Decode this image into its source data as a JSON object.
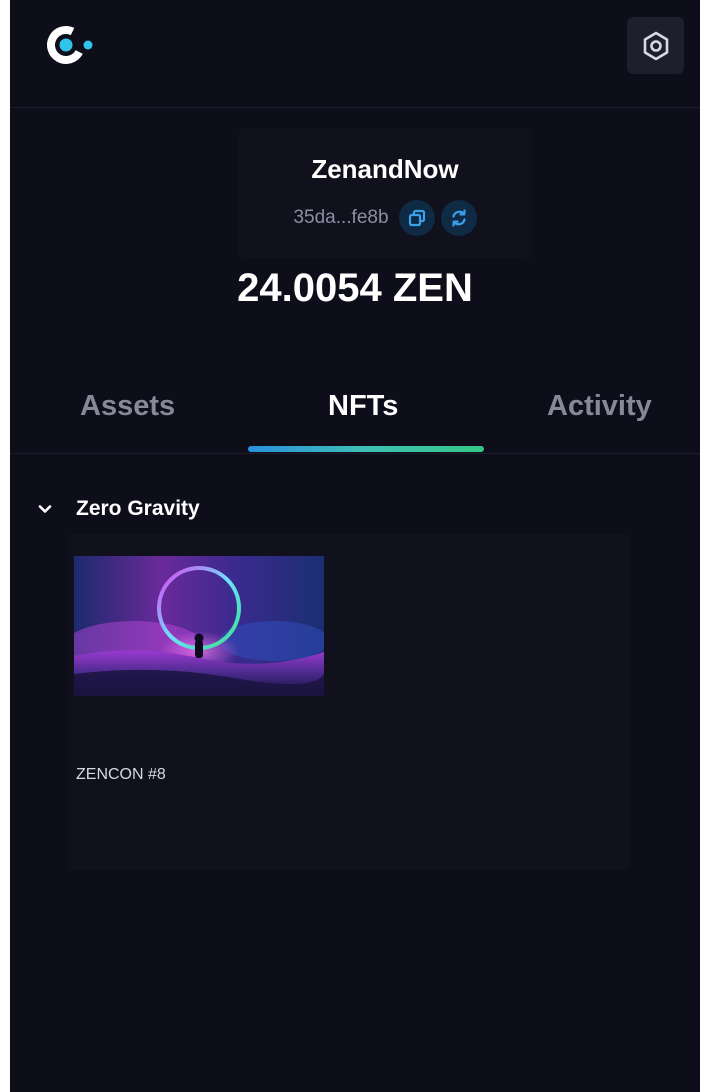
{
  "header": {
    "logo_icon": "casper-logo-icon",
    "settings_icon": "hexagon-gear-icon"
  },
  "wallet": {
    "name": "ZenandNow",
    "address_short": "35da...fe8b",
    "copy_icon": "copy-icon",
    "refresh_icon": "refresh-icon",
    "balance": "24.0054 ZEN"
  },
  "tabs": [
    {
      "label": "Assets",
      "active": false
    },
    {
      "label": "NFTs",
      "active": true
    },
    {
      "label": "Activity",
      "active": false
    }
  ],
  "collection": {
    "title": "Zero Gravity",
    "expanded": true,
    "items": [
      {
        "name": "ZENCON #8",
        "image": "astronaut-portal-artwork"
      }
    ]
  },
  "colors": {
    "background": "#0d0e1a",
    "panel": "#10111d",
    "accent_cyan": "#2fc4e8",
    "tab_gradient_start": "#2a90dc",
    "tab_gradient_end": "#35c686"
  }
}
